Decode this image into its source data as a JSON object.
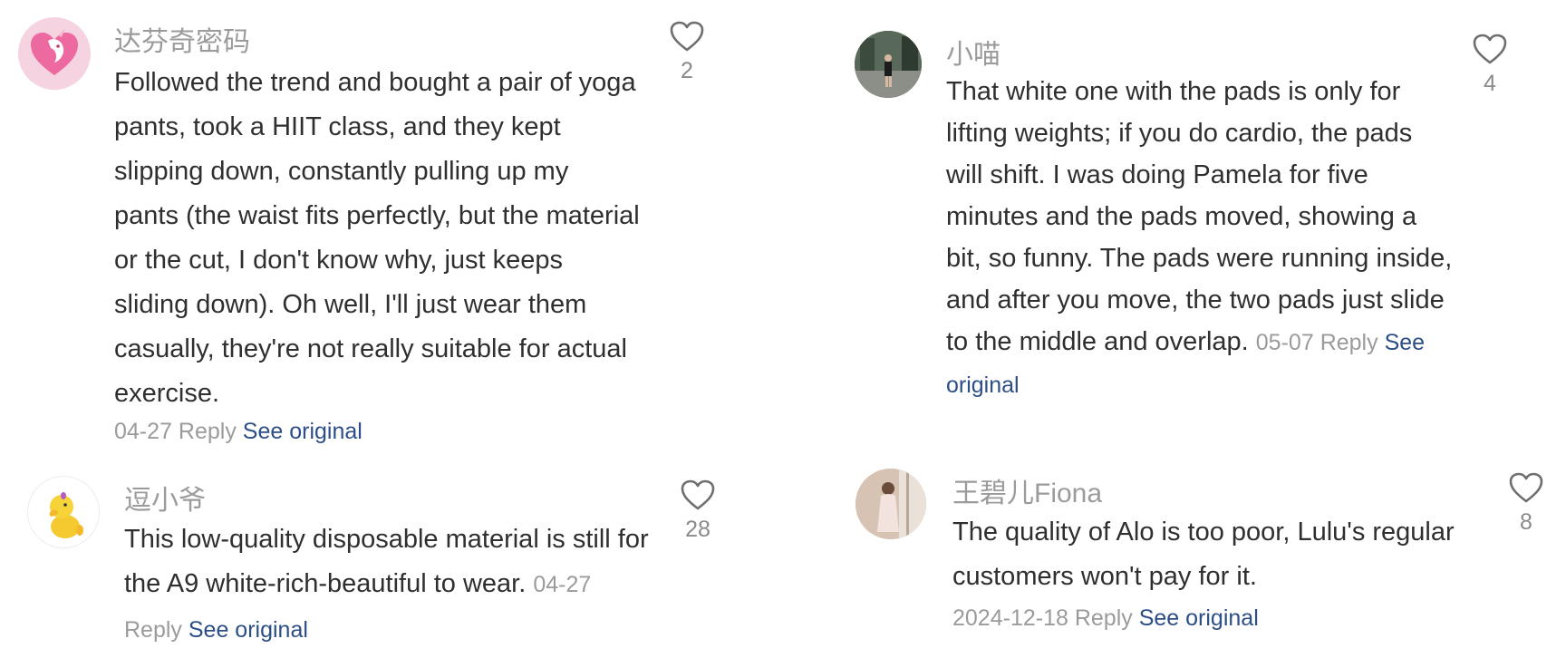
{
  "comments": [
    {
      "username": "达芬奇密码",
      "avatar": "unicorn-heart-avatar",
      "text": "Followed the trend and bought a pair of yoga pants, took a HIIT class, and they kept slipping down, constantly pulling up my pants (the waist fits perfectly, but the material or the cut, I don't know why, just keeps sliding down). Oh well, I'll just wear them casually, they're not really suitable for actual exercise.",
      "date": "04-27",
      "reply": "Reply",
      "see_original": "See original",
      "likes": "2"
    },
    {
      "username": "逗小爷",
      "avatar": "yellow-duck-avatar",
      "text": "This low-quality disposable material is still for the A9 white-rich-beautiful to wear.",
      "date": "04-27",
      "reply": "Reply",
      "see_original": "See original",
      "likes": "28"
    },
    {
      "username": "小喵",
      "avatar": "photo-avatar-street",
      "text": "That white one with the pads is only for lifting weights; if you do cardio, the pads will shift. I was doing Pamela for five minutes and the pads moved, showing a bit, so funny. The pads were running inside, and after you move, the two pads just slide to the middle and overlap.",
      "date": "05-07",
      "reply": "Reply",
      "see_original": "See original",
      "likes": "4"
    },
    {
      "username": "王碧儿Fiona",
      "avatar": "photo-avatar-woman",
      "text": "The quality of Alo is too poor, Lulu's regular customers won't pay for it.",
      "date": "2024-12-18",
      "reply": "Reply",
      "see_original": "See original",
      "likes": "8"
    }
  ],
  "colors": {
    "username": "#9b9b9b",
    "body": "#2f2f2f",
    "meta": "#9b9b9b",
    "link": "#2c4e86",
    "heart": "#6e6e6e"
  }
}
